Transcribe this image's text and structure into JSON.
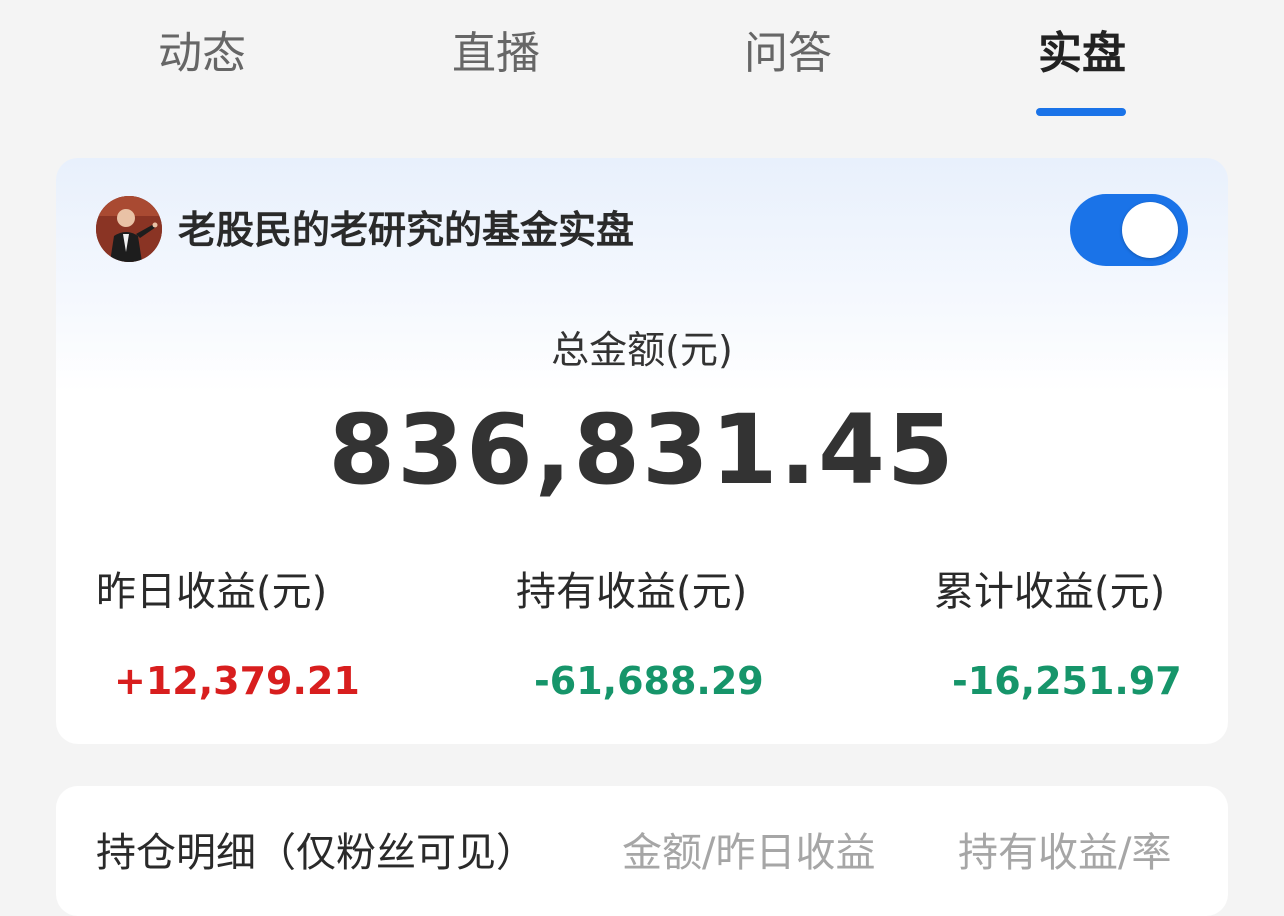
{
  "tabs": [
    {
      "label": "动态",
      "active": false
    },
    {
      "label": "直播",
      "active": false
    },
    {
      "label": "问答",
      "active": false
    },
    {
      "label": "实盘",
      "active": true
    }
  ],
  "accent_color": "#1a73e8",
  "portfolio": {
    "title": "老股民的老研究的基金实盘",
    "avatar_icon": "user-avatar",
    "toggle_on": true,
    "total_label": "总金额(元)",
    "total_value": "836,831.45",
    "stats": [
      {
        "label": "昨日收益(元)",
        "value": "+12,379.21",
        "trend": "up",
        "color": "#d81e1e"
      },
      {
        "label": "持有收益(元)",
        "value": "-61,688.29",
        "trend": "down",
        "color": "#16956a"
      },
      {
        "label": "累计收益(元)",
        "value": "-16,251.97",
        "trend": "down",
        "color": "#16956a"
      }
    ]
  },
  "holdings": {
    "title": "持仓明细（仅粉丝可见）",
    "columns": [
      "金额/昨日收益",
      "持有收益/率"
    ]
  }
}
